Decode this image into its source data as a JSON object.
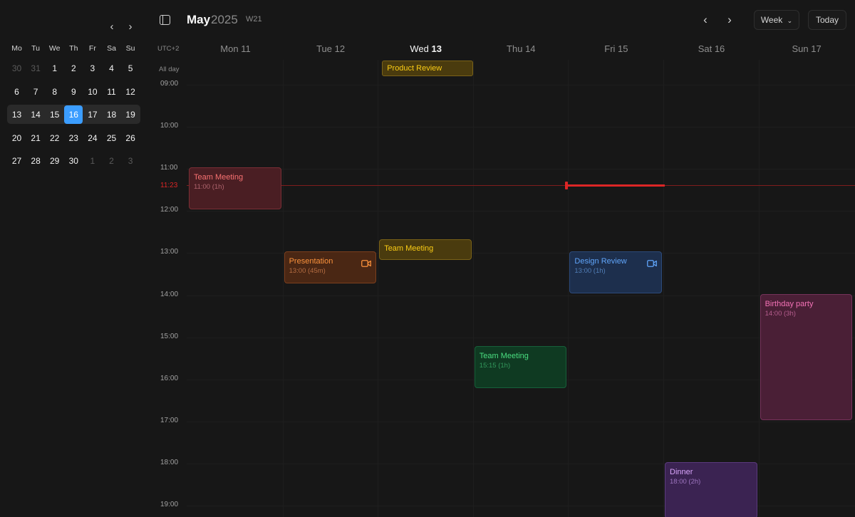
{
  "mini_calendar": {
    "weekdays": [
      "Mo",
      "Tu",
      "We",
      "Th",
      "Fr",
      "Sa",
      "Su"
    ],
    "weeks": [
      [
        "30",
        "31",
        "1",
        "2",
        "3",
        "4",
        "5"
      ],
      [
        "6",
        "7",
        "8",
        "9",
        "10",
        "11",
        "12"
      ],
      [
        "13",
        "14",
        "15",
        "16",
        "17",
        "18",
        "19"
      ],
      [
        "20",
        "21",
        "22",
        "23",
        "24",
        "25",
        "26"
      ],
      [
        "27",
        "28",
        "29",
        "30",
        "1",
        "2",
        "3"
      ]
    ],
    "muted_cells": [
      "0-0",
      "0-1",
      "4-4",
      "4-5",
      "4-6"
    ],
    "selected_cell": "2-3",
    "selected_week": 2,
    "prev_icon": "chevron-left-icon",
    "next_icon": "chevron-right-icon"
  },
  "header": {
    "month": "May",
    "year": "2025",
    "week": "W21",
    "view_label": "Week",
    "today_label": "Today"
  },
  "grid": {
    "timezone": "UTC+2",
    "all_day_label": "All day",
    "days": [
      {
        "name": "Mon",
        "num": "11"
      },
      {
        "name": "Tue",
        "num": "12"
      },
      {
        "name": "Wed",
        "num": "13"
      },
      {
        "name": "Thu",
        "num": "14"
      },
      {
        "name": "Fri",
        "num": "15"
      },
      {
        "name": "Sat",
        "num": "16"
      },
      {
        "name": "Sun",
        "num": "17"
      }
    ],
    "current_day_index": 2,
    "hours": [
      "09:00",
      "10:00",
      "11:00",
      "12:00",
      "13:00",
      "14:00",
      "15:00",
      "16:00",
      "17:00",
      "18:00",
      "19:00"
    ],
    "now_label": "11:23"
  },
  "all_day_events": [
    {
      "title": "Product Review",
      "day": 2,
      "color": "yellow"
    }
  ],
  "events": [
    {
      "title": "Team Meeting",
      "subtitle": "11:00 (1h)",
      "day": 0,
      "start": 11.0,
      "duration": 1.0,
      "color": "red",
      "video": false
    },
    {
      "title": "Presentation",
      "subtitle": "13:00 (45m)",
      "day": 1,
      "start": 13.0,
      "duration": 0.75,
      "color": "orange",
      "video": true
    },
    {
      "title": "Team Meeting",
      "subtitle": "",
      "day": 2,
      "start": 12.7,
      "duration": 0.5,
      "color": "yellow",
      "video": false
    },
    {
      "title": "Team Meeting",
      "subtitle": "15:15 (1h)",
      "day": 3,
      "start": 15.25,
      "duration": 1.0,
      "color": "green",
      "video": false
    },
    {
      "title": "Design Review",
      "subtitle": "13:00 (1h)",
      "day": 4,
      "start": 13.0,
      "duration": 1.0,
      "color": "blue",
      "video": true
    },
    {
      "title": "Dinner",
      "subtitle": "18:00 (2h)",
      "day": 5,
      "start": 18.0,
      "duration": 2.0,
      "color": "purple",
      "video": false
    },
    {
      "title": "Birthday party",
      "subtitle": "14:00 (3h)",
      "day": 6,
      "start": 14.0,
      "duration": 3.0,
      "color": "pink",
      "video": false
    }
  ],
  "colors": {
    "accent": "#3b9dff",
    "now_line": "#dc2626",
    "red": {
      "bg": "#4a1e23",
      "border": "#7a2e35",
      "title": "#f87171",
      "sub": "#c0707a"
    },
    "orange": {
      "bg": "#4a2714",
      "border": "#7c3f1d",
      "title": "#fb923c",
      "sub": "#c7794a"
    },
    "yellow": {
      "bg": "#4a3b0e",
      "border": "#7a6218",
      "title": "#facc15",
      "sub": "#c9a83d"
    },
    "green": {
      "bg": "#0f3a22",
      "border": "#16603a",
      "title": "#4ade80",
      "sub": "#39a866"
    },
    "blue": {
      "bg": "#1d2f4d",
      "border": "#2c4a7a",
      "title": "#60a5fa",
      "sub": "#5b8cc9"
    },
    "purple": {
      "bg": "#3b2352",
      "border": "#5b3a7e",
      "title": "#d8a4fb",
      "sub": "#ad82d1"
    },
    "pink": {
      "bg": "#4a1f36",
      "border": "#76325a",
      "title": "#f472b6",
      "sub": "#c7679c"
    }
  }
}
